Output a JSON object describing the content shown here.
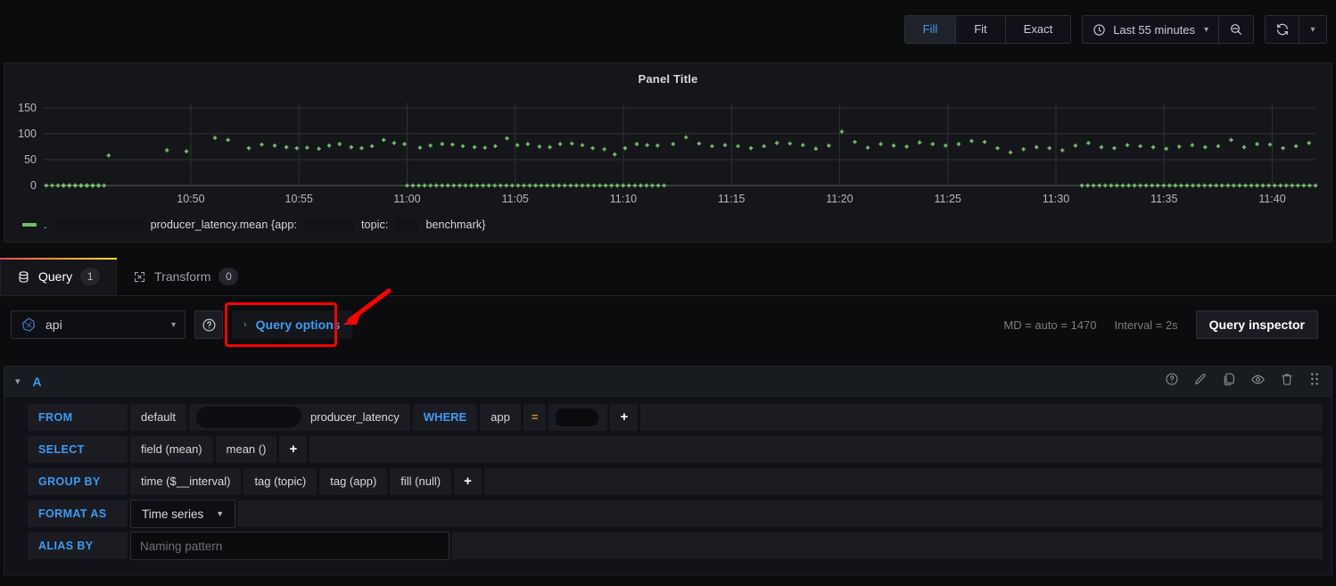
{
  "toolbar": {
    "zoom_modes": [
      {
        "label": "Fill",
        "active": true
      },
      {
        "label": "Fit",
        "active": false
      },
      {
        "label": "Exact",
        "active": false
      }
    ],
    "time_range": "Last 55 minutes",
    "clock_icon": "clock-icon",
    "zoom_out_icon": "zoom-out-icon",
    "refresh_icon": "refresh-icon",
    "caret_icon": "chevron-down-icon"
  },
  "panel": {
    "title": "Panel Title",
    "legend": {
      "prefix_redacted": true,
      "text_a": "producer_latency.mean {app:",
      "text_b": "topic:",
      "text_c": "benchmark}",
      "color": "#73bf69"
    }
  },
  "chart_data": {
    "type": "scatter",
    "title": "Panel Title",
    "xlabel": "",
    "ylabel": "",
    "ylim": [
      0,
      160
    ],
    "yticks": [
      0,
      50,
      100,
      150
    ],
    "xticks": [
      "10:50",
      "10:55",
      "11:00",
      "11:05",
      "11:10",
      "11:15",
      "11:20",
      "11:25",
      "11:30",
      "11:35",
      "11:40"
    ],
    "grid": true,
    "legend_position": "bottom",
    "series": [
      {
        "name": "producer_latency.mean {app: topic: benchmark}",
        "color": "#73bf69",
        "marker": "cross",
        "points": [
          [
            10.468,
            80
          ],
          [
            10.478,
            77
          ],
          [
            10.488,
            76
          ],
          [
            10.77,
            58
          ],
          [
            10.815,
            68
          ],
          [
            10.83,
            66
          ],
          [
            10.852,
            92
          ],
          [
            10.862,
            88
          ],
          [
            10.878,
            72
          ],
          [
            10.888,
            79
          ],
          [
            10.898,
            77
          ],
          [
            10.907,
            74
          ],
          [
            10.915,
            72
          ],
          [
            10.923,
            73
          ],
          [
            10.932,
            71
          ],
          [
            10.94,
            77
          ],
          [
            10.948,
            80
          ],
          [
            10.957,
            74
          ],
          [
            10.965,
            72
          ],
          [
            10.973,
            76
          ],
          [
            10.982,
            88
          ],
          [
            10.99,
            82
          ],
          [
            10.998,
            80
          ],
          [
            11.01,
            73
          ],
          [
            11.018,
            77
          ],
          [
            11.027,
            80
          ],
          [
            11.035,
            79
          ],
          [
            11.043,
            76
          ],
          [
            11.052,
            74
          ],
          [
            11.06,
            73
          ],
          [
            11.068,
            76
          ],
          [
            11.077,
            91
          ],
          [
            11.085,
            78
          ],
          [
            11.093,
            80
          ],
          [
            11.102,
            75
          ],
          [
            11.11,
            74
          ],
          [
            11.118,
            80
          ],
          [
            11.127,
            81
          ],
          [
            11.135,
            78
          ],
          [
            11.143,
            72
          ],
          [
            11.152,
            70
          ],
          [
            11.16,
            60
          ],
          [
            11.168,
            72
          ],
          [
            11.177,
            80
          ],
          [
            11.185,
            78
          ],
          [
            11.193,
            77
          ],
          [
            11.205,
            80
          ],
          [
            11.215,
            93
          ],
          [
            11.225,
            81
          ],
          [
            11.235,
            76
          ],
          [
            11.245,
            78
          ],
          [
            11.255,
            76
          ],
          [
            11.265,
            72
          ],
          [
            11.275,
            76
          ],
          [
            11.285,
            82
          ],
          [
            11.295,
            81
          ],
          [
            11.305,
            78
          ],
          [
            11.315,
            71
          ],
          [
            11.325,
            77
          ],
          [
            11.335,
            104
          ],
          [
            11.345,
            84
          ],
          [
            11.355,
            73
          ],
          [
            11.365,
            80
          ],
          [
            11.375,
            77
          ],
          [
            11.385,
            75
          ],
          [
            11.395,
            83
          ],
          [
            11.405,
            80
          ],
          [
            11.415,
            77
          ],
          [
            11.425,
            80
          ],
          [
            11.435,
            86
          ],
          [
            11.445,
            84
          ],
          [
            11.455,
            72
          ],
          [
            11.465,
            64
          ],
          [
            11.475,
            70
          ],
          [
            11.485,
            74
          ],
          [
            11.495,
            72
          ],
          [
            11.505,
            68
          ],
          [
            11.515,
            77
          ],
          [
            11.525,
            82
          ],
          [
            11.535,
            74
          ],
          [
            11.545,
            72
          ],
          [
            11.555,
            78
          ],
          [
            11.565,
            76
          ],
          [
            11.575,
            74
          ],
          [
            11.585,
            71
          ],
          [
            11.595,
            75
          ],
          [
            11.605,
            78
          ],
          [
            11.615,
            74
          ],
          [
            11.625,
            76
          ],
          [
            11.635,
            88
          ],
          [
            11.645,
            74
          ],
          [
            11.655,
            80
          ],
          [
            11.665,
            79
          ],
          [
            11.675,
            72
          ],
          [
            11.685,
            76
          ],
          [
            11.695,
            82
          ]
        ],
        "zero_runs": [
          [
            10.47,
            10.765
          ],
          [
            11.0,
            11.2
          ],
          [
            11.52,
            11.7
          ]
        ]
      }
    ]
  },
  "tabs": [
    {
      "label": "Query",
      "badge": "1",
      "icon": "database-icon",
      "active": true
    },
    {
      "label": "Transform",
      "badge": "0",
      "icon": "transform-icon",
      "active": false
    }
  ],
  "query_bar": {
    "datasource": "api",
    "datasource_icon": "influxdb-icon",
    "help_icon": "help-circle-icon",
    "query_options_label": "Query options",
    "query_options_caret": "chevron-right-icon",
    "max_data_points": "MD = auto = 1470",
    "interval": "Interval = 2s",
    "query_inspector_label": "Query inspector"
  },
  "query_editor": {
    "ref_id": "A",
    "collapse_icon": "chevron-down-icon",
    "actions": [
      {
        "name": "help-icon"
      },
      {
        "name": "pencil-icon"
      },
      {
        "name": "copy-icon"
      },
      {
        "name": "eye-icon"
      },
      {
        "name": "trash-icon"
      },
      {
        "name": "drag-handle-icon"
      }
    ],
    "rows": {
      "from": {
        "label": "FROM",
        "policy": "default",
        "measurement": "producer_latency",
        "where_keyword": "WHERE",
        "where_field": "app",
        "where_operator": "=",
        "where_value_redacted": true,
        "add": "+"
      },
      "select": {
        "label": "SELECT",
        "field": "field (mean)",
        "func": "mean ()",
        "add": "+"
      },
      "group_by": {
        "label": "GROUP BY",
        "items": [
          "time ($__interval)",
          "tag (topic)",
          "tag (app)",
          "fill (null)"
        ],
        "add": "+"
      },
      "format_as": {
        "label": "FORMAT AS",
        "value": "Time series"
      },
      "alias_by": {
        "label": "ALIAS BY",
        "value": "",
        "placeholder": "Naming pattern"
      }
    }
  },
  "annotation": {
    "highlight_color": "#ff0000",
    "arrow": "red-arrow-pointing-to-query-options"
  }
}
